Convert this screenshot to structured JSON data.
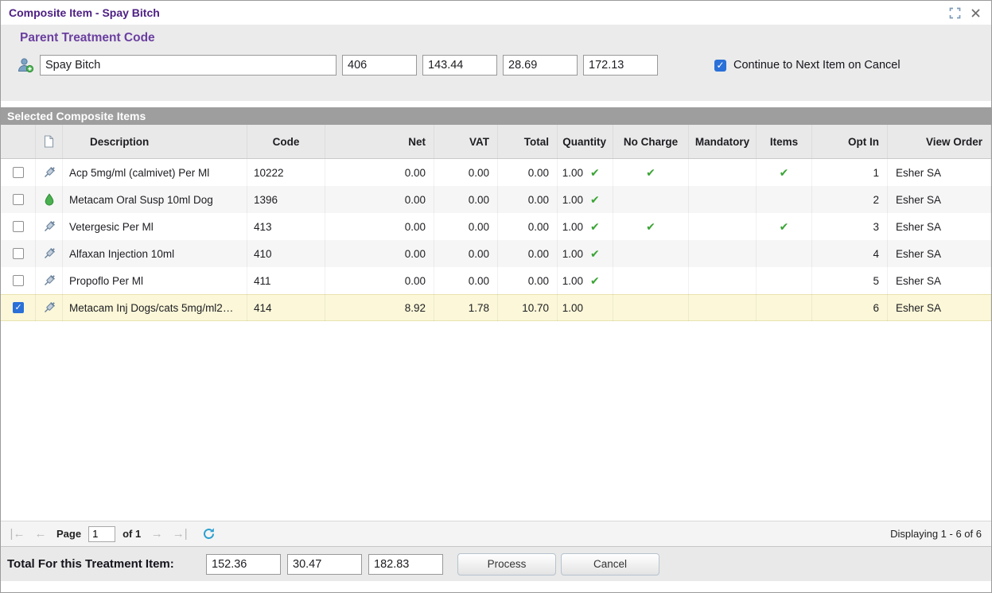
{
  "window": {
    "title": "Composite Item - Spay Bitch"
  },
  "icons": {
    "check_glyph": "✔",
    "first": "|←",
    "prev": "←",
    "next": "→",
    "last": "→|"
  },
  "parent": {
    "heading": "Parent Treatment Code",
    "name": "Spay Bitch",
    "code": "406",
    "net": "143.44",
    "vat": "28.69",
    "total": "172.13",
    "continue_checkbox_label": "Continue to Next Item on Cancel",
    "continue_checked": true
  },
  "items": {
    "section_title": "Selected Composite Items",
    "columns": [
      "Description",
      "Code",
      "Net",
      "VAT",
      "Total",
      "Quantity",
      "No Charge",
      "Mandatory",
      "Items",
      "Opt In",
      "View Order"
    ],
    "rows": [
      {
        "selected": false,
        "icon": "syringe",
        "description": "Acp 5mg/ml (calmivet) Per Ml",
        "code": "10222",
        "net": "0.00",
        "vat": "0.00",
        "total": "0.00",
        "quantity": "1.00",
        "quantity_check": true,
        "no_charge": true,
        "mandatory": false,
        "items_check": true,
        "opt_in": "1",
        "view_order": "Esher SA"
      },
      {
        "selected": false,
        "icon": "droplet",
        "description": "Metacam Oral Susp 10ml Dog",
        "code": "1396",
        "net": "0.00",
        "vat": "0.00",
        "total": "0.00",
        "quantity": "1.00",
        "quantity_check": true,
        "no_charge": false,
        "mandatory": false,
        "items_check": false,
        "opt_in": "2",
        "view_order": "Esher SA"
      },
      {
        "selected": false,
        "icon": "syringe",
        "description": "Vetergesic Per Ml",
        "code": "413",
        "net": "0.00",
        "vat": "0.00",
        "total": "0.00",
        "quantity": "1.00",
        "quantity_check": true,
        "no_charge": true,
        "mandatory": false,
        "items_check": true,
        "opt_in": "3",
        "view_order": "Esher SA"
      },
      {
        "selected": false,
        "icon": "syringe",
        "description": "Alfaxan Injection 10ml",
        "code": "410",
        "net": "0.00",
        "vat": "0.00",
        "total": "0.00",
        "quantity": "1.00",
        "quantity_check": true,
        "no_charge": false,
        "mandatory": false,
        "items_check": false,
        "opt_in": "4",
        "view_order": "Esher SA"
      },
      {
        "selected": false,
        "icon": "syringe",
        "description": "Propoflo Per Ml",
        "code": "411",
        "net": "0.00",
        "vat": "0.00",
        "total": "0.00",
        "quantity": "1.00",
        "quantity_check": true,
        "no_charge": false,
        "mandatory": false,
        "items_check": false,
        "opt_in": "5",
        "view_order": "Esher SA"
      },
      {
        "selected": true,
        "icon": "syringe",
        "description": "Metacam Inj Dogs/cats 5mg/ml2…",
        "code": "414",
        "net": "8.92",
        "vat": "1.78",
        "total": "10.70",
        "quantity": "1.00",
        "quantity_check": false,
        "no_charge": false,
        "mandatory": false,
        "items_check": false,
        "opt_in": "6",
        "view_order": "Esher SA"
      }
    ]
  },
  "pagination": {
    "page_label": "Page",
    "page_value": "1",
    "of_label": "of 1",
    "displaying": "Displaying 1 - 6 of 6"
  },
  "footer": {
    "label": "Total For this Treatment Item:",
    "net": "152.36",
    "vat": "30.47",
    "total": "182.83",
    "process_label": "Process",
    "cancel_label": "Cancel"
  },
  "colors": {
    "title": "#4e2083",
    "heading": "#6b3fa0",
    "section_bar": "#9e9e9e",
    "selected_row": "#fbf7d8",
    "check_green": "#3aa435",
    "checkbox_blue": "#2a70d8"
  }
}
